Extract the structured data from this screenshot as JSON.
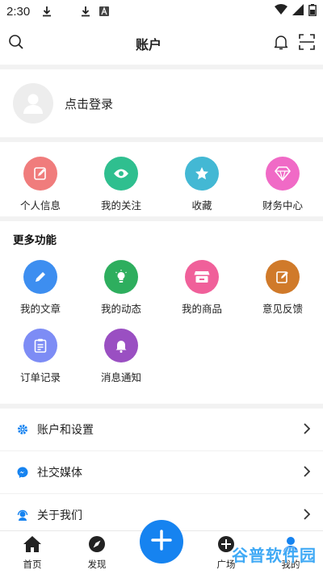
{
  "status_bar": {
    "time": "2:30"
  },
  "header": {
    "title": "账户"
  },
  "login": {
    "text": "点击登录"
  },
  "quick_actions": [
    {
      "label": "个人信息",
      "color": "#f07c7c",
      "icon": "edit-icon"
    },
    {
      "label": "我的关注",
      "color": "#2fbf8f",
      "icon": "eye-icon"
    },
    {
      "label": "收藏",
      "color": "#43b8d4",
      "icon": "star-icon"
    },
    {
      "label": "财务中心",
      "color": "#f06ac6",
      "icon": "diamond-icon"
    }
  ],
  "more": {
    "title": "更多功能",
    "items": [
      {
        "label": "我的文章",
        "color": "#3d8ef0",
        "icon": "pencil-icon"
      },
      {
        "label": "我的动态",
        "color": "#2eae5e",
        "icon": "bulb-icon"
      },
      {
        "label": "我的商品",
        "color": "#f0609a",
        "icon": "store-icon"
      },
      {
        "label": "意见反馈",
        "color": "#d07a2a",
        "icon": "feedback-icon"
      },
      {
        "label": "订单记录",
        "color": "#7d8cf5",
        "icon": "clipboard-icon"
      },
      {
        "label": "消息通知",
        "color": "#9a4fc2",
        "icon": "bell-icon"
      }
    ]
  },
  "list": [
    {
      "label": "账户和设置",
      "icon": "gear-icon"
    },
    {
      "label": "社交媒体",
      "icon": "messenger-icon"
    },
    {
      "label": "关于我们",
      "icon": "support-icon"
    }
  ],
  "tabs": [
    {
      "label": "首页",
      "icon": "home-icon"
    },
    {
      "label": "发现",
      "icon": "compass-icon"
    },
    {
      "label": "广场",
      "icon": "square-icon"
    },
    {
      "label": "我的",
      "icon": "user-icon"
    }
  ],
  "watermark": "谷普软件园",
  "colors": {
    "accent": "#1683f0"
  }
}
